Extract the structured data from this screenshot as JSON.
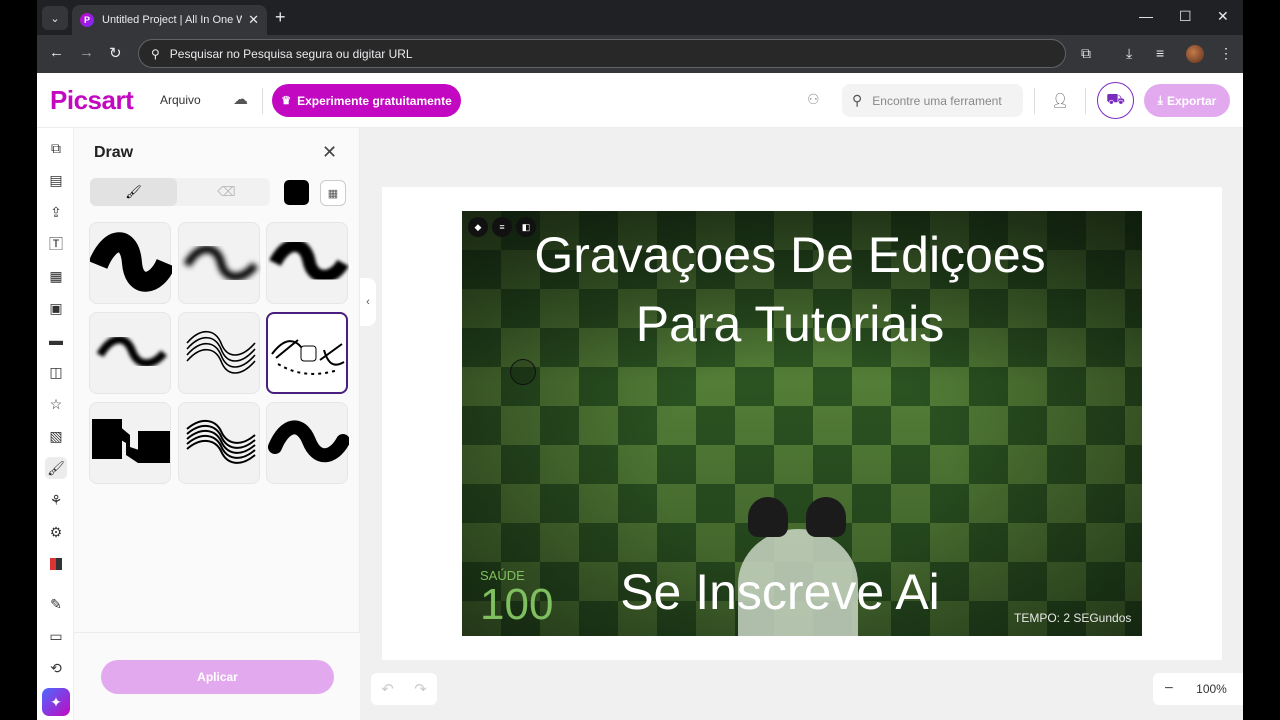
{
  "browser": {
    "tab_title": "Untitled Project | All In One We",
    "address": "Pesquisar no Pesquisa segura ou digitar URL"
  },
  "header": {
    "logo": "Picsart",
    "file_menu": "Arquivo",
    "try_button": "Experimente gratuitamente",
    "search_placeholder": "Encontre uma ferrament",
    "export_button": "Exportar"
  },
  "rail": {
    "icons": [
      "templates-icon",
      "grid-icon",
      "upload-icon",
      "text-icon",
      "layout-icon",
      "image-icon",
      "video-icon",
      "sticker-icon",
      "star-icon",
      "pattern-icon",
      "brush-icon",
      "shapes-icon",
      "effects-icon",
      "apps-icon",
      "palette-icon",
      "folder-icon",
      "link-icon",
      "ai-icon"
    ]
  },
  "panel": {
    "title": "Draw",
    "apply_button": "Aplicar",
    "selected_brush": 6,
    "color": "#000000"
  },
  "canvas": {
    "title_line1": "Gravaçoes De Ediçoes",
    "title_line2": "Para Tutoriais",
    "subtitle": "Se Inscreve Ai",
    "health_label": "SAÚDE",
    "health_value": "100",
    "time_label": "TEMPO: 2 SEGundos"
  },
  "zoom": {
    "level": "100%"
  },
  "colors": {
    "brand": "#c209c1",
    "export_disabled": "#e3a9ef",
    "selected_border": "#4a1e7e"
  }
}
